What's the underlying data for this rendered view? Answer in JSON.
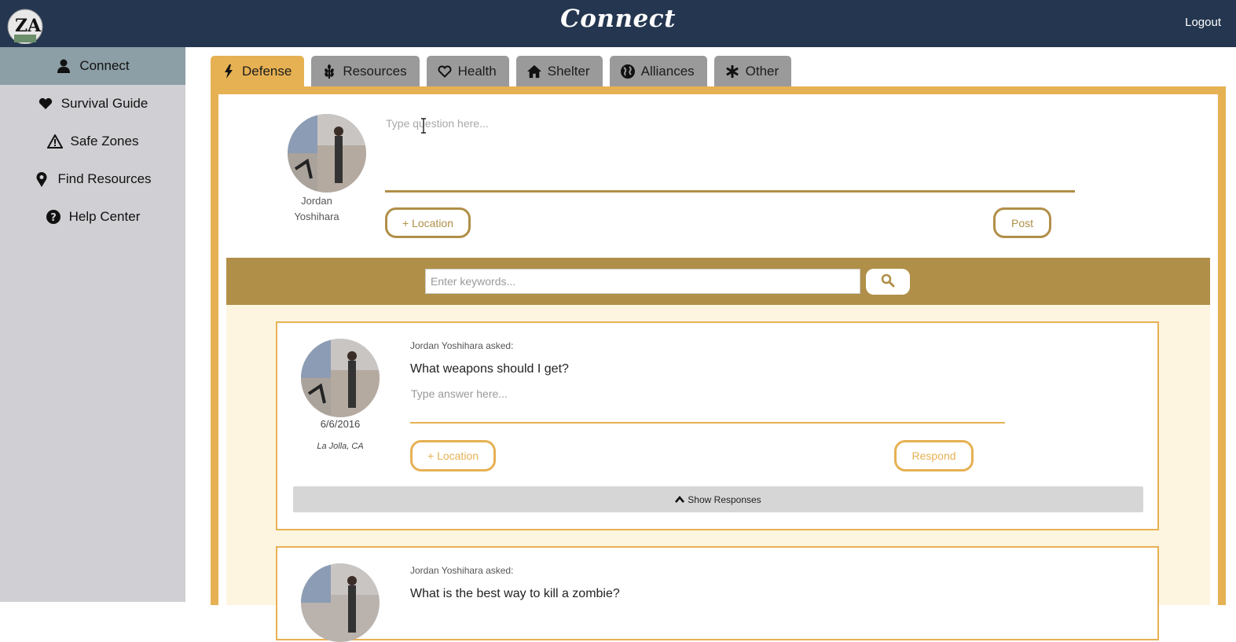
{
  "header": {
    "title": "Connect",
    "logout_label": "Logout",
    "logo_text": "ZA",
    "colors": {
      "bar": "#243650",
      "accent": "#e6b153",
      "dark_accent": "#b08f48"
    }
  },
  "sidebar": {
    "items": [
      {
        "label": "Connect",
        "icon": "person-icon",
        "active": true
      },
      {
        "label": "Survival Guide",
        "icon": "heart-icon"
      },
      {
        "label": "Safe Zones",
        "icon": "warning-icon"
      },
      {
        "label": "Find Resources",
        "icon": "map-pin-icon"
      },
      {
        "label": "Help Center",
        "icon": "question-circle-icon"
      }
    ]
  },
  "tabs": [
    {
      "label": "Defense",
      "icon": "bolt-icon",
      "active": true
    },
    {
      "label": "Resources",
      "icon": "wheat-icon"
    },
    {
      "label": "Health",
      "icon": "heart-outline-icon"
    },
    {
      "label": "Shelter",
      "icon": "home-icon"
    },
    {
      "label": "Alliances",
      "icon": "globe-icon"
    },
    {
      "label": "Other",
      "icon": "asterisk-icon"
    }
  ],
  "composer": {
    "user_first": "Jordan",
    "user_last": "Yoshihara",
    "placeholder": "Type question here...",
    "location_label": "+ Location",
    "post_label": "Post"
  },
  "search": {
    "placeholder": "Enter keywords..."
  },
  "feed": [
    {
      "asker": "Jordan Yoshihara asked:",
      "question": "What weapons should I get?",
      "answer_placeholder": "Type answer here...",
      "date": "6/6/2016",
      "location": "La Jolla, CA",
      "location_label": "+ Location",
      "respond_label": "Respond",
      "show_responses": "Show Responses"
    },
    {
      "asker": "Jordan Yoshihara asked:",
      "question": "What is the best way to kill a zombie?"
    }
  ]
}
